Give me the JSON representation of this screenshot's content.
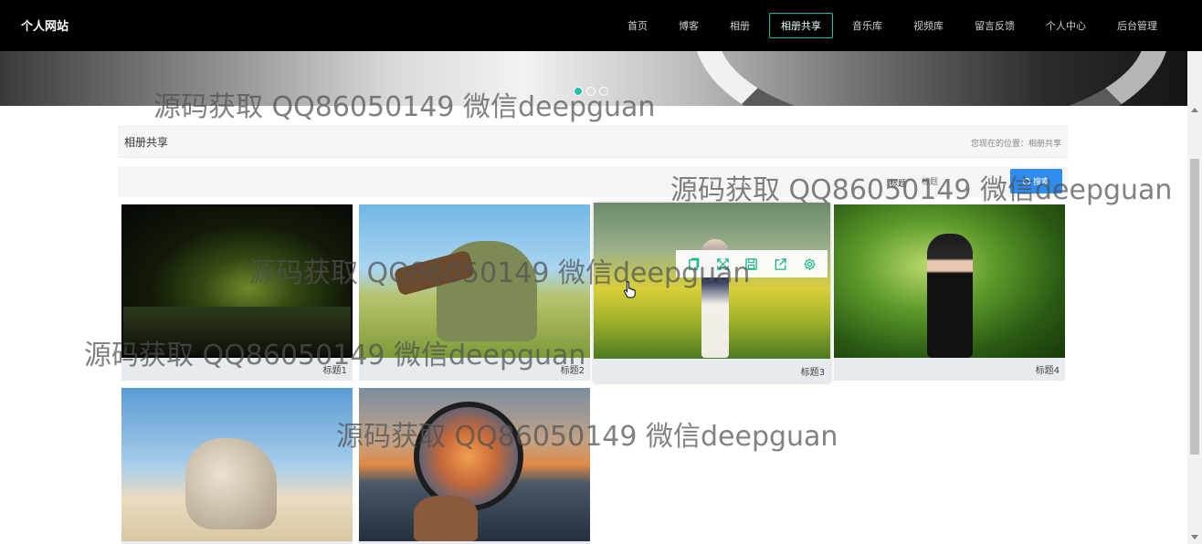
{
  "site": {
    "brand": "个人网站"
  },
  "nav": {
    "items": [
      {
        "label": "首页"
      },
      {
        "label": "博客"
      },
      {
        "label": "相册"
      },
      {
        "label": "相册共享",
        "active": true
      },
      {
        "label": "音乐库"
      },
      {
        "label": "视频库"
      },
      {
        "label": "留言反馈"
      },
      {
        "label": "个人中心"
      },
      {
        "label": "后台管理"
      }
    ]
  },
  "banner": {
    "dots": 3,
    "active_dot": 0
  },
  "breadcrumb": {
    "page_title": "相册共享",
    "location_label": "您现在的位置：",
    "current": "相册共享"
  },
  "search": {
    "label": "标题",
    "placeholder": "标题",
    "button_label": "搜索"
  },
  "gallery": {
    "items": [
      {
        "caption": "标题1"
      },
      {
        "caption": "标题2"
      },
      {
        "caption": "标题3"
      },
      {
        "caption": "标题4"
      },
      {
        "caption": "",
        "caption_visible": false
      },
      {
        "caption": "",
        "caption_visible": false
      }
    ],
    "hover_toolbar_icons": [
      "copy-icon",
      "fullscreen-icon",
      "save-icon",
      "share-icon",
      "settings-icon"
    ]
  },
  "watermark": {
    "text": "源码获取 QQ86050149 微信deepguan"
  },
  "colors": {
    "accent": "#27c0a8",
    "search_button": "#2e8cf0",
    "topbar": "#000000",
    "toolbar_icon": "#19b38a"
  }
}
